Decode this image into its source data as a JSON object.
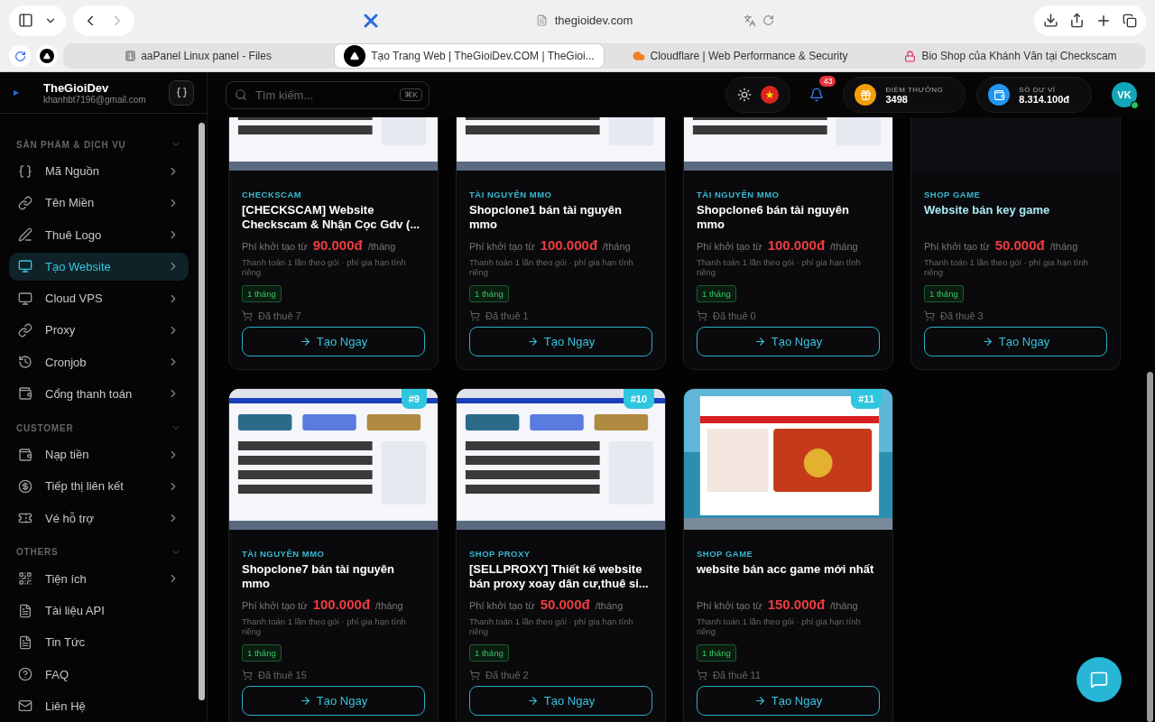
{
  "browser": {
    "address": "thegioidev.com",
    "tabs": [
      {
        "title": "aaPanel Linux panel - Files",
        "badge": "1",
        "selected": false
      },
      {
        "title": "Tạo Trang Web | TheGioiDev.COM | TheGioi...",
        "selected": true
      },
      {
        "title": "Cloudflare | Web Performance & Security",
        "selected": false
      },
      {
        "title": "Bio Shop của Khánh Văn tại Checkscam",
        "selected": false
      }
    ]
  },
  "sidebar": {
    "brand": "TheGioiDev",
    "email": "khanhbt7196@gmail.com",
    "sections": [
      {
        "title": "SẢN PHẨM & DỊCH VỤ",
        "expanded": true,
        "items": [
          {
            "label": "Mã Nguồn",
            "has_submenu": true,
            "selected": false
          },
          {
            "label": "Tên Miền",
            "has_submenu": true,
            "selected": false
          },
          {
            "label": "Thuê Logo",
            "has_submenu": true,
            "selected": false
          },
          {
            "label": "Tạo Website",
            "has_submenu": true,
            "selected": true
          },
          {
            "label": "Cloud VPS",
            "has_submenu": true,
            "selected": false
          },
          {
            "label": "Proxy",
            "has_submenu": true,
            "selected": false
          },
          {
            "label": "Cronjob",
            "has_submenu": true,
            "selected": false
          },
          {
            "label": "Cổng thanh toán",
            "has_submenu": true,
            "selected": false
          }
        ]
      },
      {
        "title": "CUSTOMER",
        "expanded": true,
        "items": [
          {
            "label": "Nạp tiền",
            "has_submenu": true,
            "selected": false
          },
          {
            "label": "Tiếp thị liên kết",
            "has_submenu": true,
            "selected": false
          },
          {
            "label": "Vé hỗ trợ",
            "has_submenu": true,
            "selected": false
          }
        ]
      },
      {
        "title": "OTHERS",
        "expanded": true,
        "items": [
          {
            "label": "Tiện ích",
            "has_submenu": true,
            "selected": false
          },
          {
            "label": "Tài liệu API",
            "has_submenu": false,
            "selected": false
          },
          {
            "label": "Tin Tức",
            "has_submenu": false,
            "selected": false
          },
          {
            "label": "FAQ",
            "has_submenu": false,
            "selected": false
          },
          {
            "label": "Liên Hệ",
            "has_submenu": false,
            "selected": false
          }
        ]
      }
    ]
  },
  "header": {
    "search": {
      "placeholder": "Tìm kiếm...",
      "shortcut": "⌘K"
    },
    "notifications": "43",
    "points": {
      "label": "ĐIỂM THƯỞNG",
      "value": "3498"
    },
    "wallet": {
      "label": "SỐ DƯ VÍ",
      "value": "8.314.100đ"
    },
    "avatar": {
      "initials": "VK",
      "online": true
    }
  },
  "products": [
    {
      "category": "CHECKSCAM",
      "title": "[CHECKSCAM] Website Checkscam & Nhận Cọc Gdv (...",
      "highlighted": false,
      "price_label": "Phí khởi tạo từ",
      "price": "90.000đ",
      "period": "/tháng",
      "note": "Thanh toán 1 lần theo gói · phí gia hạn tính riêng",
      "duration": "1 tháng",
      "rented": "Đã thuê 7",
      "button": "Tạo Ngay"
    },
    {
      "category": "TÀI NGUYÊN MMO",
      "title": "Shopclone1 bán tài nguyên mmo",
      "highlighted": false,
      "price_label": "Phí khởi tạo từ",
      "price": "100.000đ",
      "period": "/tháng",
      "note": "Thanh toán 1 lần theo gói · phí gia hạn tính riêng",
      "duration": "1 tháng",
      "rented": "Đã thuê 1",
      "button": "Tạo Ngay"
    },
    {
      "category": "TÀI NGUYÊN MMO",
      "title": "Shopclone6 bán tài nguyên mmo",
      "highlighted": false,
      "price_label": "Phí khởi tạo từ",
      "price": "100.000đ",
      "period": "/tháng",
      "note": "Thanh toán 1 lần theo gói · phí gia hạn tính riêng",
      "duration": "1 tháng",
      "rented": "Đã thuê 0",
      "button": "Tạo Ngay"
    },
    {
      "category": "SHOP GAME",
      "title": "Website bán key game",
      "highlighted": true,
      "price_label": "Phí khởi tạo từ",
      "price": "50.000đ",
      "period": "/tháng",
      "note": "Thanh toán 1 lần theo gói · phí gia hạn tính riêng",
      "duration": "1 tháng",
      "rented": "Đã thuê 3",
      "button": "Tạo Ngay"
    },
    {
      "badge": "#9",
      "category": "TÀI NGUYÊN MMO",
      "title": "Shopclone7 bán tài nguyên mmo",
      "highlighted": false,
      "price_label": "Phí khởi tạo từ",
      "price": "100.000đ",
      "period": "/tháng",
      "note": "Thanh toán 1 lần theo gói · phí gia hạn tính riêng",
      "duration": "1 tháng",
      "rented": "Đã thuê 15",
      "button": "Tạo Ngay"
    },
    {
      "badge": "#10",
      "category": "SHOP PROXY",
      "title": "[SELLPROXY] Thiết kế website bán proxy xoay dân cư,thuê si...",
      "highlighted": false,
      "price_label": "Phí khởi tạo từ",
      "price": "50.000đ",
      "period": "/tháng",
      "note": "Thanh toán 1 lần theo gói · phí gia hạn tính riêng",
      "duration": "1 tháng",
      "rented": "Đã thuê 2",
      "button": "Tạo Ngay"
    },
    {
      "badge": "#11",
      "category": "SHOP GAME",
      "title": "website bán acc game mới nhất",
      "highlighted": false,
      "price_label": "Phí khởi tạo từ",
      "price": "150.000đ",
      "period": "/tháng",
      "note": "Thanh toán 1 lần theo gói · phí gia hạn tính riêng",
      "duration": "1 tháng",
      "rented": "Đã thuê 11",
      "button": "Tạo Ngay"
    }
  ]
}
